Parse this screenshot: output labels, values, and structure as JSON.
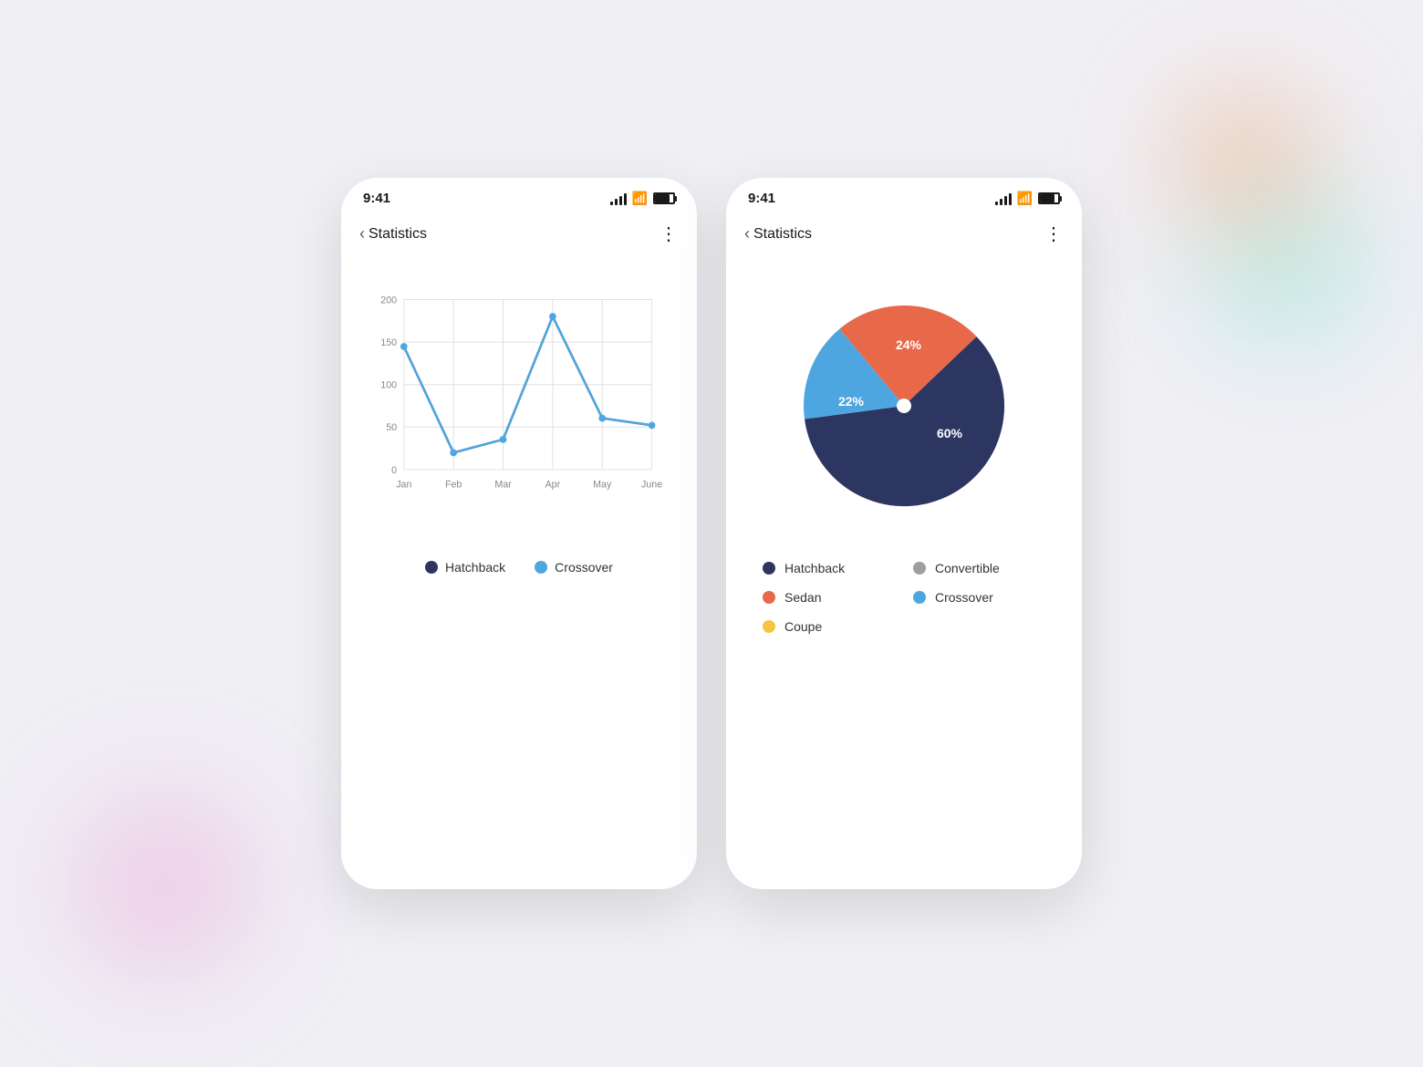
{
  "background": {
    "color": "#f0eff4"
  },
  "phone_left": {
    "status_bar": {
      "time": "9:41",
      "signal": "signal",
      "wifi": "wifi",
      "battery": "battery"
    },
    "header": {
      "back_label": "Statistics",
      "more_label": "⋮"
    },
    "line_chart": {
      "y_labels": [
        "200",
        "150",
        "100",
        "50",
        "0"
      ],
      "x_labels": [
        "Jan",
        "Feb",
        "Mar",
        "Apr",
        "May",
        "June"
      ],
      "hatchback_data": [
        145,
        20,
        35,
        180,
        60,
        52
      ],
      "crossover_data": [
        145,
        20,
        35,
        180,
        60,
        52
      ],
      "hatchback_color": "#2d3561",
      "crossover_color": "#4da6e0"
    },
    "legend": {
      "items": [
        {
          "label": "Hatchback",
          "color": "#2d3561"
        },
        {
          "label": "Crossover",
          "color": "#4da6e0"
        }
      ]
    }
  },
  "phone_right": {
    "status_bar": {
      "time": "9:41",
      "signal": "signal",
      "wifi": "wifi",
      "battery": "battery"
    },
    "header": {
      "back_label": "Statistics",
      "more_label": "⋮"
    },
    "pie_chart": {
      "segments": [
        {
          "label": "Hatchback",
          "value": 60,
          "color": "#2d3561",
          "text_color": "#ffffff"
        },
        {
          "label": "Sedan",
          "value": 24,
          "color": "#e8694a",
          "text_color": "#ffffff"
        },
        {
          "label": "Crossover",
          "value": 22,
          "color": "#4da6e0",
          "text_color": "#ffffff"
        }
      ]
    },
    "pie_legend": {
      "items": [
        {
          "label": "Hatchback",
          "color": "#2d3561"
        },
        {
          "label": "Convertible",
          "color": "#9e9e9e"
        },
        {
          "label": "Sedan",
          "color": "#e8694a"
        },
        {
          "label": "Crossover",
          "color": "#4da6e0"
        },
        {
          "label": "Coupe",
          "color": "#f5c542"
        }
      ]
    }
  }
}
